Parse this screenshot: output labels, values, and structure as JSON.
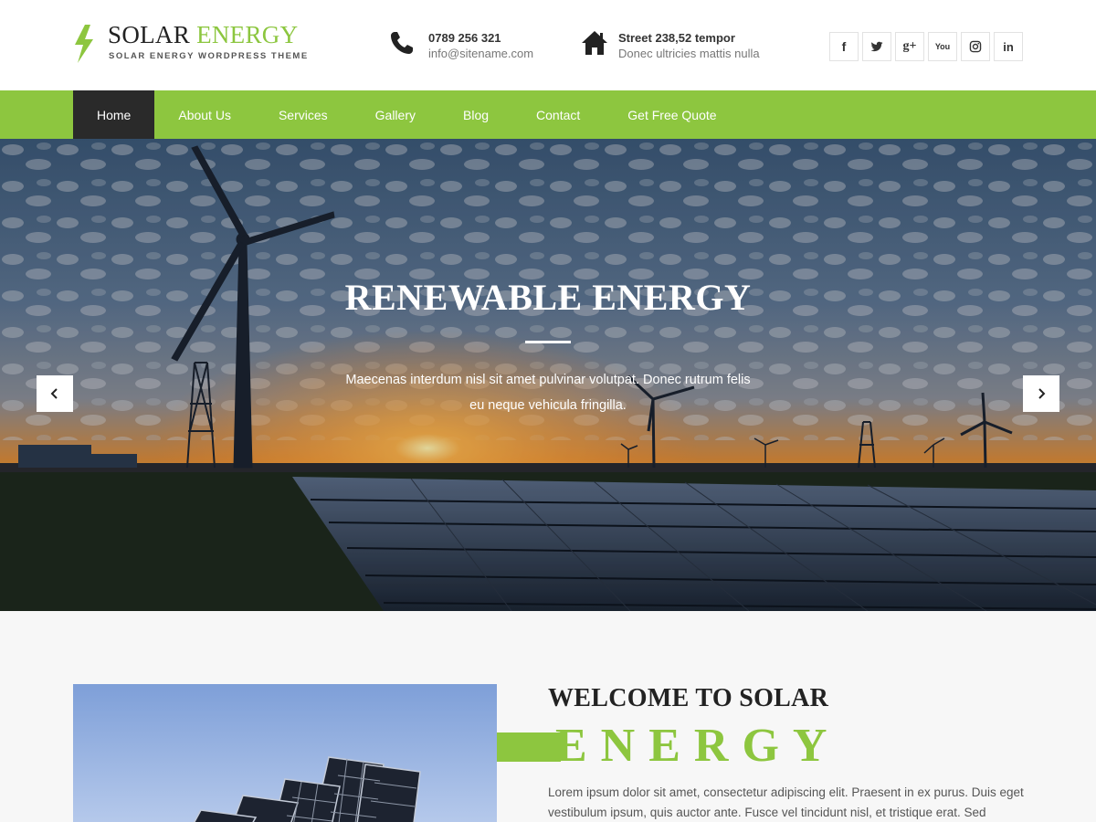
{
  "brand": {
    "title_word1": "SOLAR",
    "title_word2": "ENERGY",
    "tagline": "SOLAR ENERGY WORDPRESS THEME",
    "accent_color": "#8dc63f",
    "dark_color": "#2a2a2a"
  },
  "header": {
    "phone": {
      "icon": "phone-icon",
      "line1": "0789 256 321",
      "line2": "info@sitename.com"
    },
    "address": {
      "icon": "home-icon",
      "line1": "Street 238,52 tempor",
      "line2": "Donec ultricies mattis nulla"
    },
    "social": [
      {
        "name": "facebook",
        "label": "f"
      },
      {
        "name": "twitter",
        "label": ""
      },
      {
        "name": "google-plus",
        "label": "g+"
      },
      {
        "name": "youtube",
        "label": "You"
      },
      {
        "name": "instagram",
        "label": ""
      },
      {
        "name": "linkedin",
        "label": "in"
      }
    ]
  },
  "nav": {
    "items": [
      "Home",
      "About Us",
      "Services",
      "Gallery",
      "Blog",
      "Contact",
      "Get Free Quote"
    ],
    "active_index": 0
  },
  "hero": {
    "title": "RENEWABLE ENERGY",
    "text": "Maecenas interdum nisl sit amet pulvinar volutpat. Donec rutrum felis eu neque vehicula fringilla.",
    "prev_icon": "chevron-left-icon",
    "next_icon": "chevron-right-icon"
  },
  "welcome": {
    "title": "WELCOME TO SOLAR",
    "highlight": "ENERGY",
    "text": "Lorem ipsum dolor sit amet, consectetur adipiscing elit. Praesent in ex purus. Duis eget vestibulum ipsum, quis auctor ante. Fusce vel tincidunt nisl, et tristique erat. Sed elementum"
  }
}
